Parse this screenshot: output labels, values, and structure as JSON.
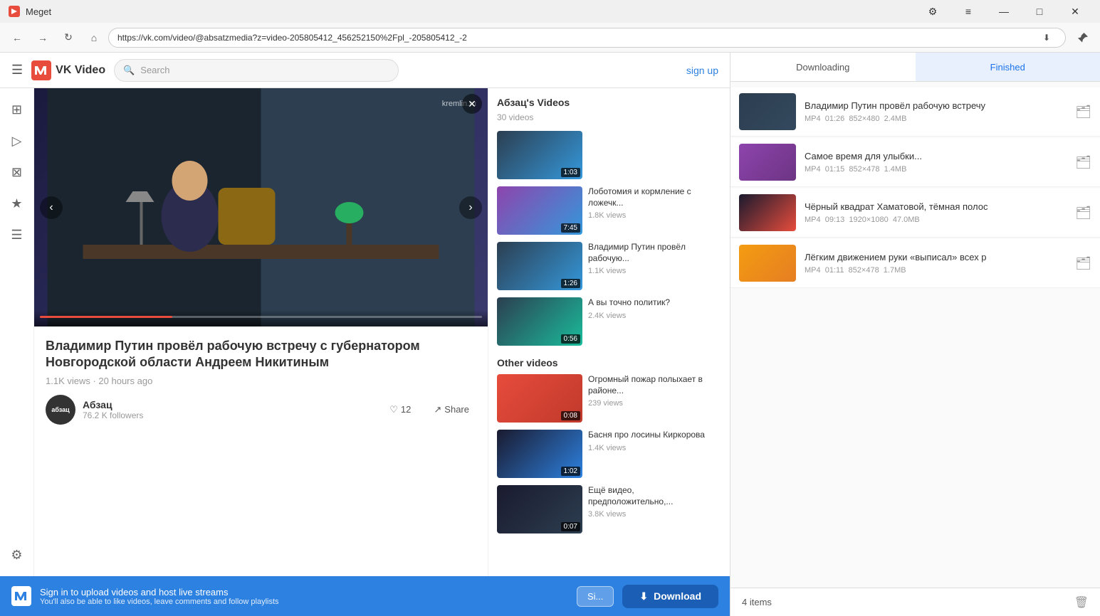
{
  "titlebar": {
    "title": "Meget",
    "icon": "M",
    "controls": {
      "settings": "⚙",
      "menu": "≡",
      "minimize": "—",
      "maximize": "□",
      "close": "✕"
    }
  },
  "navbar": {
    "back": "←",
    "forward": "→",
    "refresh": "↻",
    "home": "⌂",
    "url": "https://vk.com/video/@absatzmedia?z=video-205805412_456252150%2Fpl_-205805412_-2",
    "download_icon": "⬇",
    "pin_icon": "📌"
  },
  "vk_header": {
    "menu_icon": "☰",
    "logo_text": "VK Video",
    "search_placeholder": "Search",
    "signup": "sign up"
  },
  "video": {
    "watermark": "kremlin.ru",
    "title": "Владимир Путин провёл рабочую встречу с губернатором Новгородской области Андреем Никитиным",
    "stats": "1.1K views · 20 hours ago",
    "author_name": "Абзац",
    "author_avatar_text": "абзац",
    "followers": "76.2 K followers",
    "likes": "12",
    "share": "Share"
  },
  "related_channel": {
    "title": "Абзац's Videos",
    "count": "30 videos",
    "videos": [
      {
        "duration": "1:03",
        "color": "thumb-color-1"
      },
      {
        "title": "Лоботомия и кормление с ложечк...",
        "views": "1.8K views",
        "duration": "7:45",
        "color": "thumb-color-2"
      },
      {
        "title": "Владимир Путин провёл рабочую...",
        "views": "1.1K views",
        "duration": "1:26",
        "color": "thumb-color-1"
      },
      {
        "title": "А вы точно политик?",
        "views": "2.4K views",
        "duration": "0:56",
        "color": "thumb-color-4"
      }
    ]
  },
  "other_videos": {
    "title": "Other videos",
    "videos": [
      {
        "title": "Огромный пожар полыхает в районе...",
        "views": "239 views",
        "duration": "0:08",
        "color": "thumb-color-5"
      },
      {
        "title": "Басня про лосины Киркорова",
        "views": "1.4K views",
        "duration": "1:02",
        "color": "thumb-color-6"
      },
      {
        "title": "Ещё видео, предположительно,...",
        "views": "3.8K views",
        "duration": "0:07",
        "color": "thumb-color-8"
      }
    ]
  },
  "downloads_panel": {
    "tabs": {
      "downloading": "Downloading",
      "finished": "Finished"
    },
    "items": [
      {
        "title": "Владимир Путин провёл рабочую встречу",
        "format": "MP4",
        "duration": "01:26",
        "resolution": "852×480",
        "size": "2.4MB",
        "thumb_color": "dl-thumb-1"
      },
      {
        "title": "Самое время для улыбки...",
        "format": "MP4",
        "duration": "01:15",
        "resolution": "852×478",
        "size": "1.4MB",
        "thumb_color": "dl-thumb-2"
      },
      {
        "title": "Чёрный квадрат Хаматовой, тёмная полос",
        "format": "MP4",
        "duration": "09:13",
        "resolution": "1920×1080",
        "size": "47.0MB",
        "thumb_color": "dl-thumb-3"
      },
      {
        "title": "Лёгким движением руки «выписал» всех р",
        "format": "MP4",
        "duration": "01:11",
        "resolution": "852×478",
        "size": "1.7MB",
        "thumb_color": "dl-thumb-4"
      }
    ],
    "footer": {
      "items_count": "4 items",
      "trash_icon": "🗑"
    }
  },
  "notification": {
    "main_text": "Sign in to upload videos and host live streams",
    "sub_text": "You'll also be able to like videos, leave comments and follow playlists",
    "signin_btn": "Si...",
    "download_btn": "Download",
    "download_icon": "⬇"
  }
}
